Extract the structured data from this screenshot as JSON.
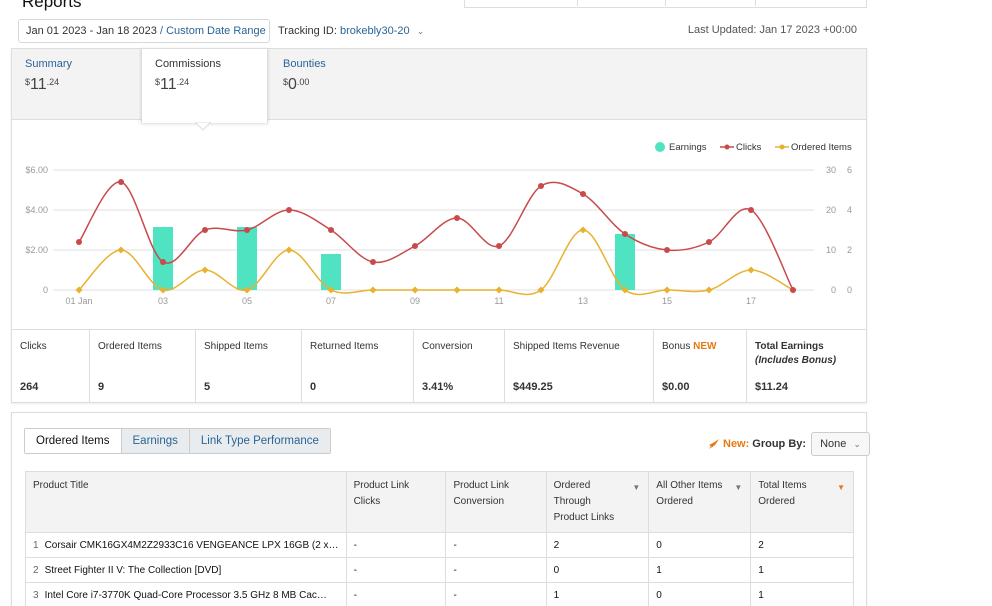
{
  "page": {
    "title": "Reports"
  },
  "filters": {
    "date_range": "Jan 01 2023 - Jan 18 2023",
    "separator": "/",
    "range_type": "Custom Date Range",
    "tracking_label": "Tracking ID:",
    "tracking_id": "brokebly30-20",
    "last_updated": "Last Updated: Jan 17 2023 +00:00"
  },
  "summary_tabs": [
    {
      "label": "Summary",
      "dollar": "$",
      "whole": "11",
      "cents": ".24"
    },
    {
      "label": "Commissions",
      "dollar": "$",
      "whole": "11",
      "cents": ".24"
    },
    {
      "label": "Bounties",
      "dollar": "$",
      "whole": "0",
      "cents": ".00"
    }
  ],
  "chart_data": {
    "type": "bar+line",
    "legend": [
      "Earnings",
      "Clicks",
      "Ordered Items"
    ],
    "colors": {
      "earnings": "#4fe3c1",
      "clicks": "#c94a4a",
      "ordered": "#e8b230",
      "grid": "#e0e0e0",
      "axis_text": "#999"
    },
    "x_labels": [
      "01 Jan",
      "03",
      "05",
      "07",
      "09",
      "11",
      "13",
      "15",
      "17"
    ],
    "days": [
      1,
      2,
      3,
      4,
      5,
      6,
      7,
      8,
      9,
      10,
      11,
      12,
      13,
      14,
      15,
      16,
      17,
      18
    ],
    "earnings_ylim": [
      0,
      6
    ],
    "earnings_ticks": [
      "$6.00",
      "$4.00",
      "$2.00",
      "0"
    ],
    "clicks_ylim": [
      0,
      30
    ],
    "clicks_ticks": [
      "30",
      "20",
      "10",
      "0"
    ],
    "ordered_ylim": [
      0,
      6
    ],
    "ordered_ticks": [
      "6",
      "4",
      "2",
      "0"
    ],
    "earnings": [
      0,
      0,
      3.15,
      0,
      3.15,
      0,
      1.8,
      0,
      0,
      0,
      0,
      0,
      0,
      2.8,
      0,
      0,
      0,
      0
    ],
    "clicks": [
      12,
      27,
      7,
      15,
      15,
      20,
      15,
      7,
      11,
      18,
      11,
      26,
      24,
      14,
      10,
      12,
      20,
      0
    ],
    "ordered": [
      0,
      2,
      0,
      1,
      0,
      2,
      0,
      0,
      0,
      0,
      0,
      0,
      3,
      0,
      0,
      0,
      1,
      0
    ]
  },
  "metrics": [
    {
      "label": "Clicks",
      "value": "264"
    },
    {
      "label": "Ordered Items",
      "value": "9"
    },
    {
      "label": "Shipped Items",
      "value": "5"
    },
    {
      "label": "Returned Items",
      "value": "0"
    },
    {
      "label": "Conversion",
      "value": "3.41%"
    },
    {
      "label": "Shipped Items Revenue",
      "value": "$449.25"
    },
    {
      "label": "Bonus",
      "badge": "NEW",
      "value": "$0.00"
    },
    {
      "label": "Total Earnings",
      "sub": "(Includes Bonus)",
      "value": "$11.24"
    }
  ],
  "bottom_tabs": [
    "Ordered Items",
    "Earnings",
    "Link Type Performance"
  ],
  "group_by": {
    "new_label": "New:",
    "label": "Group By:",
    "value": "None"
  },
  "table": {
    "headers": [
      "Product Title",
      "Product Link Clicks",
      "Product Link Conversion",
      "Ordered Through Product Links",
      "All Other Items Ordered",
      "Total Items Ordered"
    ],
    "rows": [
      {
        "n": "1",
        "title": "Corsair CMK16GX4M2Z2933C16 VENGEANCE LPX 16GB (2 x…",
        "clicks": "-",
        "conv": "-",
        "ordered": "2",
        "other": "0",
        "total": "2"
      },
      {
        "n": "2",
        "title": "Street Fighter II V: The Collection [DVD]",
        "clicks": "-",
        "conv": "-",
        "ordered": "0",
        "other": "1",
        "total": "1"
      },
      {
        "n": "3",
        "title": "Intel Core i7-3770K Quad-Core Processor 3.5 GHz 8 MB Cac…",
        "clicks": "-",
        "conv": "-",
        "ordered": "1",
        "other": "0",
        "total": "1"
      }
    ]
  }
}
